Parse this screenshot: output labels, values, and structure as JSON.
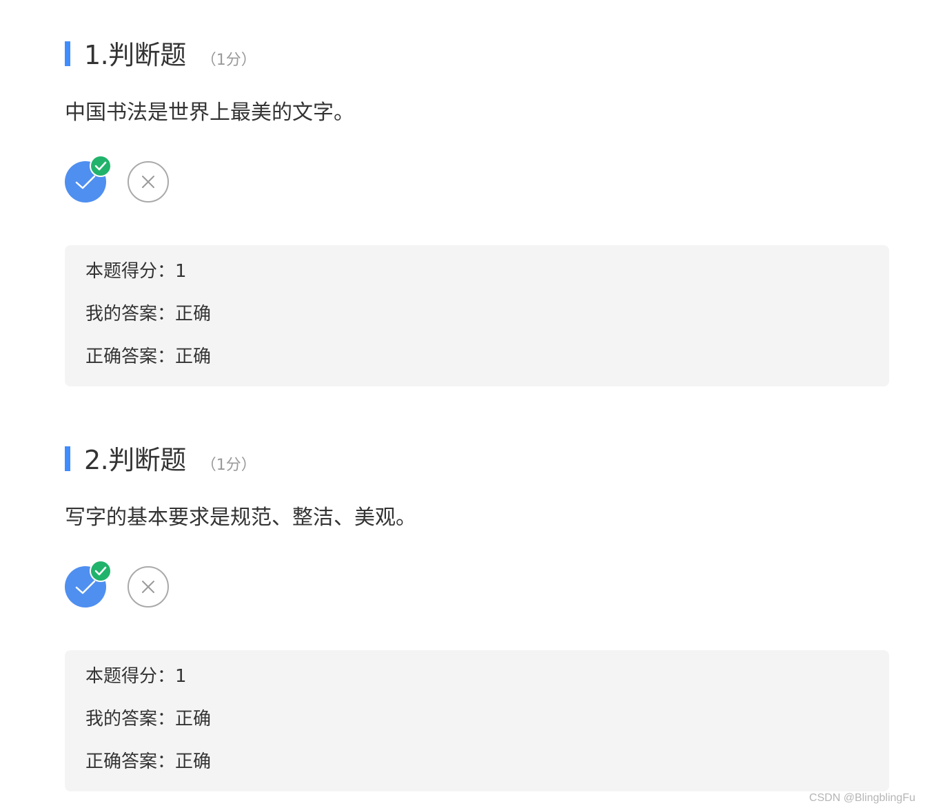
{
  "questions": [
    {
      "title": "1.判断题",
      "score_hint": "（1分）",
      "stem": "中国书法是世界上最美的文字。",
      "result": {
        "score_line": "本题得分：1",
        "my_answer_line": "我的答案：正确",
        "correct_answer_line": "正确答案：正确"
      }
    },
    {
      "title": "2.判断题",
      "score_hint": "（1分）",
      "stem": "写字的基本要求是规范、整洁、美观。",
      "result": {
        "score_line": "本题得分：1",
        "my_answer_line": "我的答案：正确",
        "correct_answer_line": "正确答案：正确"
      }
    }
  ],
  "icons": {
    "true_option": "check-icon",
    "false_option": "x-icon",
    "correct_badge": "check-badge-icon"
  },
  "colors": {
    "accent": "#3f8cff",
    "selected_option": "#4f8ff0",
    "correct_badge": "#21b36b",
    "result_bg": "#f4f4f4"
  },
  "watermark": "CSDN @BlingblingFu"
}
